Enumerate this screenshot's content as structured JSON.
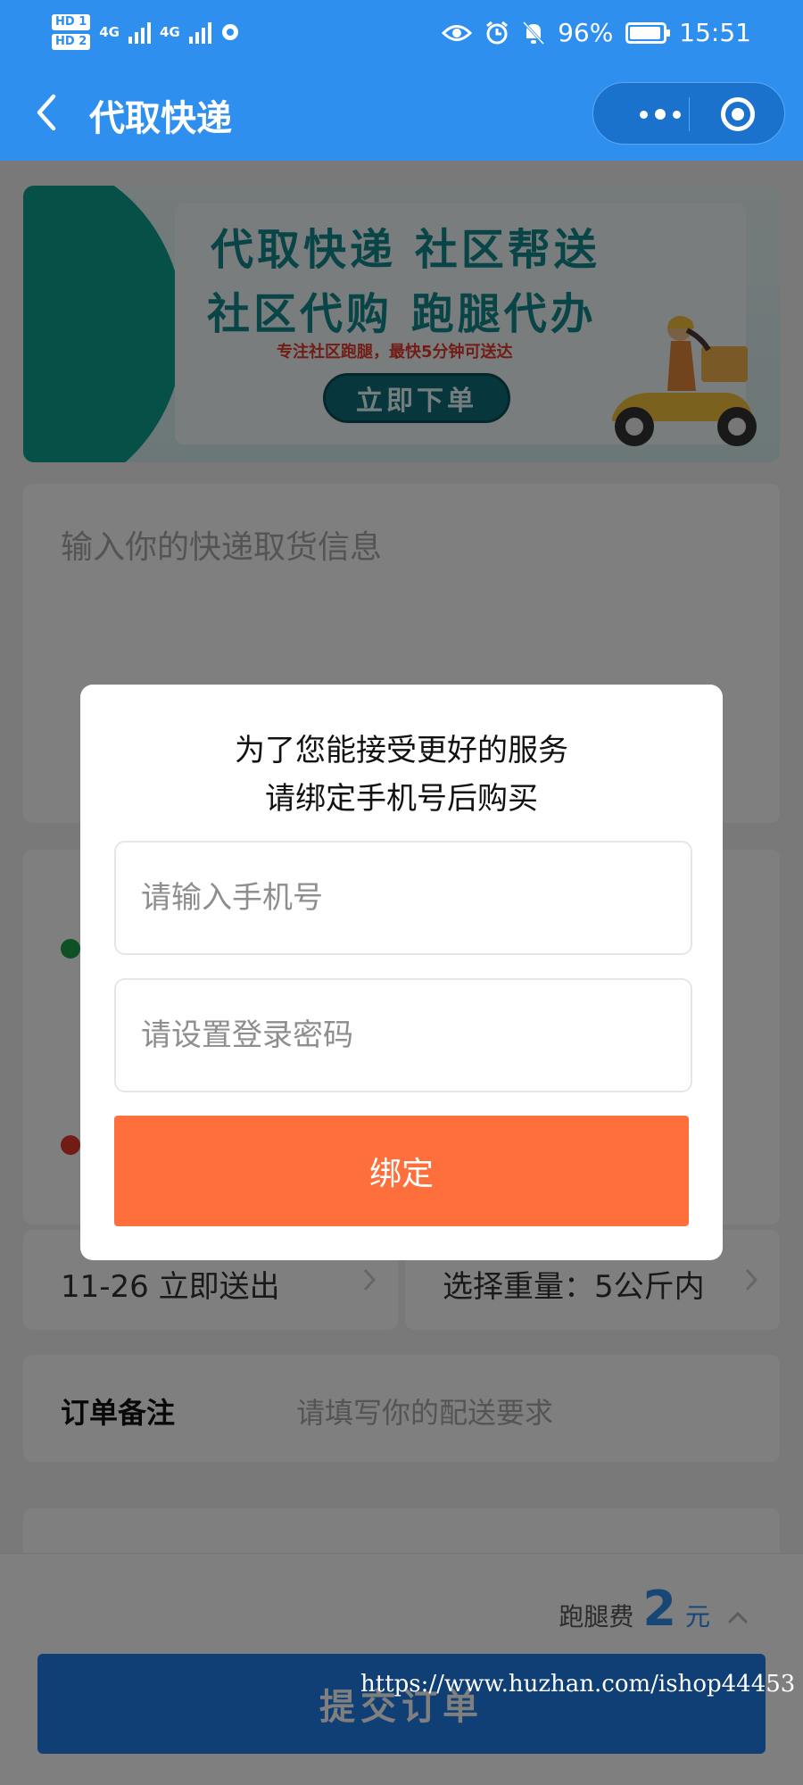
{
  "status_bar": {
    "hd1": "HD 1",
    "hd2": "HD 2",
    "net1": "4G",
    "net2": "4G",
    "battery": "96%",
    "time": "15:51"
  },
  "header": {
    "title": "代取快递",
    "background": "#2f8fee"
  },
  "banner": {
    "line1": "代取快递 社区帮送",
    "line2": "社区代购  跑腿代办",
    "subtitle": "专注社区跑腿，最快5分钟可送达",
    "cta": "立即下单"
  },
  "form": {
    "pickup_placeholder": "输入你的快递取货信息",
    "time_value": "11-26 立即送出",
    "weight_value": "选择重量：5公斤内",
    "remark_label": "订单备注",
    "remark_placeholder": "请填写你的配送要求"
  },
  "footer": {
    "fee_label": "跑腿费",
    "fee_amount": "2",
    "fee_unit": "元",
    "submit_label": "提交订单"
  },
  "modal": {
    "title_line1": "为了您能接受更好的服务",
    "title_line2": "请绑定手机号后购买",
    "phone_placeholder": "请输入手机号",
    "password_placeholder": "请设置登录密码",
    "bind_label": "绑定",
    "bind_color": "#ff6f3c"
  },
  "watermark": "https://www.huzhan.com/ishop44453"
}
